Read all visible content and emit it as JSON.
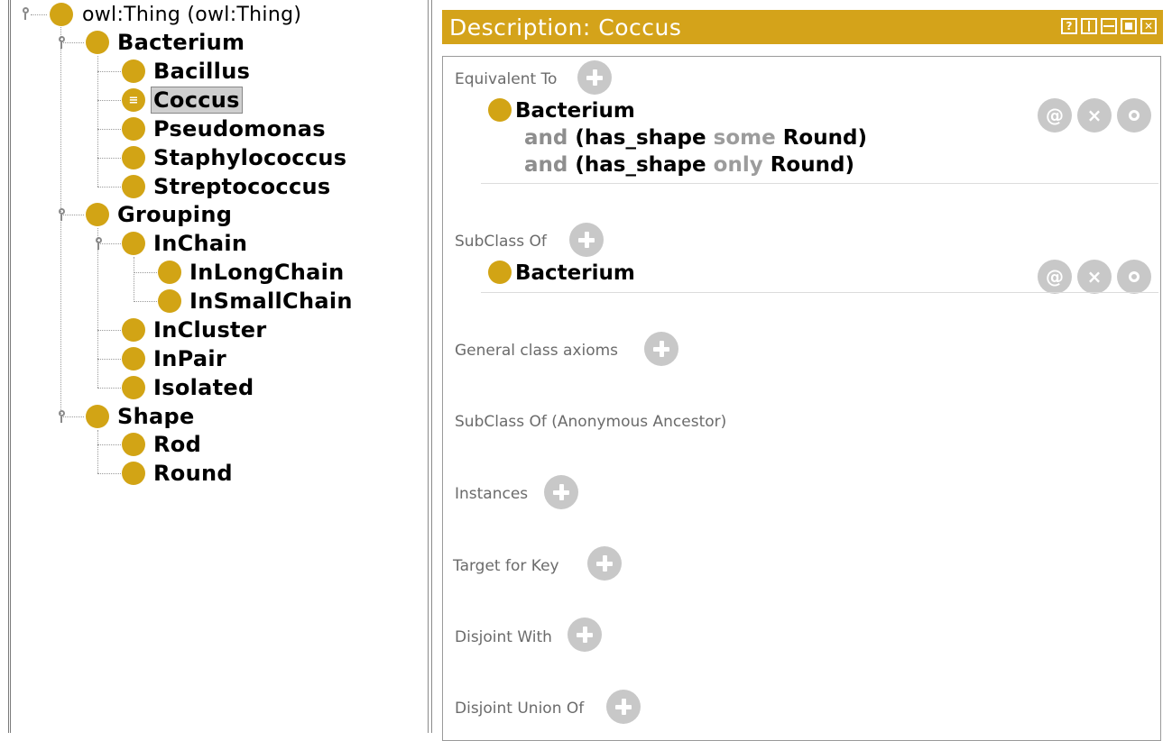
{
  "tree": {
    "root_label": "owl:Thing (owl:Thing)",
    "nodes": [
      {
        "label": "Bacterium"
      },
      {
        "label": "Bacillus"
      },
      {
        "label": "Coccus"
      },
      {
        "label": "Pseudomonas"
      },
      {
        "label": "Staphylococcus"
      },
      {
        "label": "Streptococcus"
      },
      {
        "label": "Grouping"
      },
      {
        "label": "InChain"
      },
      {
        "label": "InLongChain"
      },
      {
        "label": "InSmallChain"
      },
      {
        "label": "InCluster"
      },
      {
        "label": "InPair"
      },
      {
        "label": "Isolated"
      },
      {
        "label": "Shape"
      },
      {
        "label": "Rod"
      },
      {
        "label": "Round"
      }
    ],
    "selected": "Coccus"
  },
  "description": {
    "title": "Description: Coccus",
    "window_buttons": [
      "?",
      "",
      "",
      "",
      "✕"
    ],
    "sections": {
      "equivalent_to": "Equivalent To",
      "subclass_of": "SubClass Of",
      "general_class_axioms": "General class axioms",
      "subclass_of_anon": "SubClass Of (Anonymous Ancestor)",
      "instances": "Instances",
      "target_for_key": "Target for Key",
      "disjoint_with": "Disjoint With",
      "disjoint_union_of": "Disjoint Union Of"
    },
    "equivalent": {
      "class": "Bacterium",
      "line2": {
        "and": "and",
        "open": "(has_shape",
        "quant": "some",
        "filler": "Round)"
      },
      "line3": {
        "and": "and",
        "open": "(has_shape",
        "quant": "only",
        "filler": "Round)"
      }
    },
    "subclass": {
      "class": "Bacterium"
    },
    "action_icons": [
      "@",
      "×",
      "o"
    ]
  },
  "colors": {
    "class_dot": "#d2a415",
    "header": "#d4a31a",
    "selection": "#cfcfcf"
  }
}
